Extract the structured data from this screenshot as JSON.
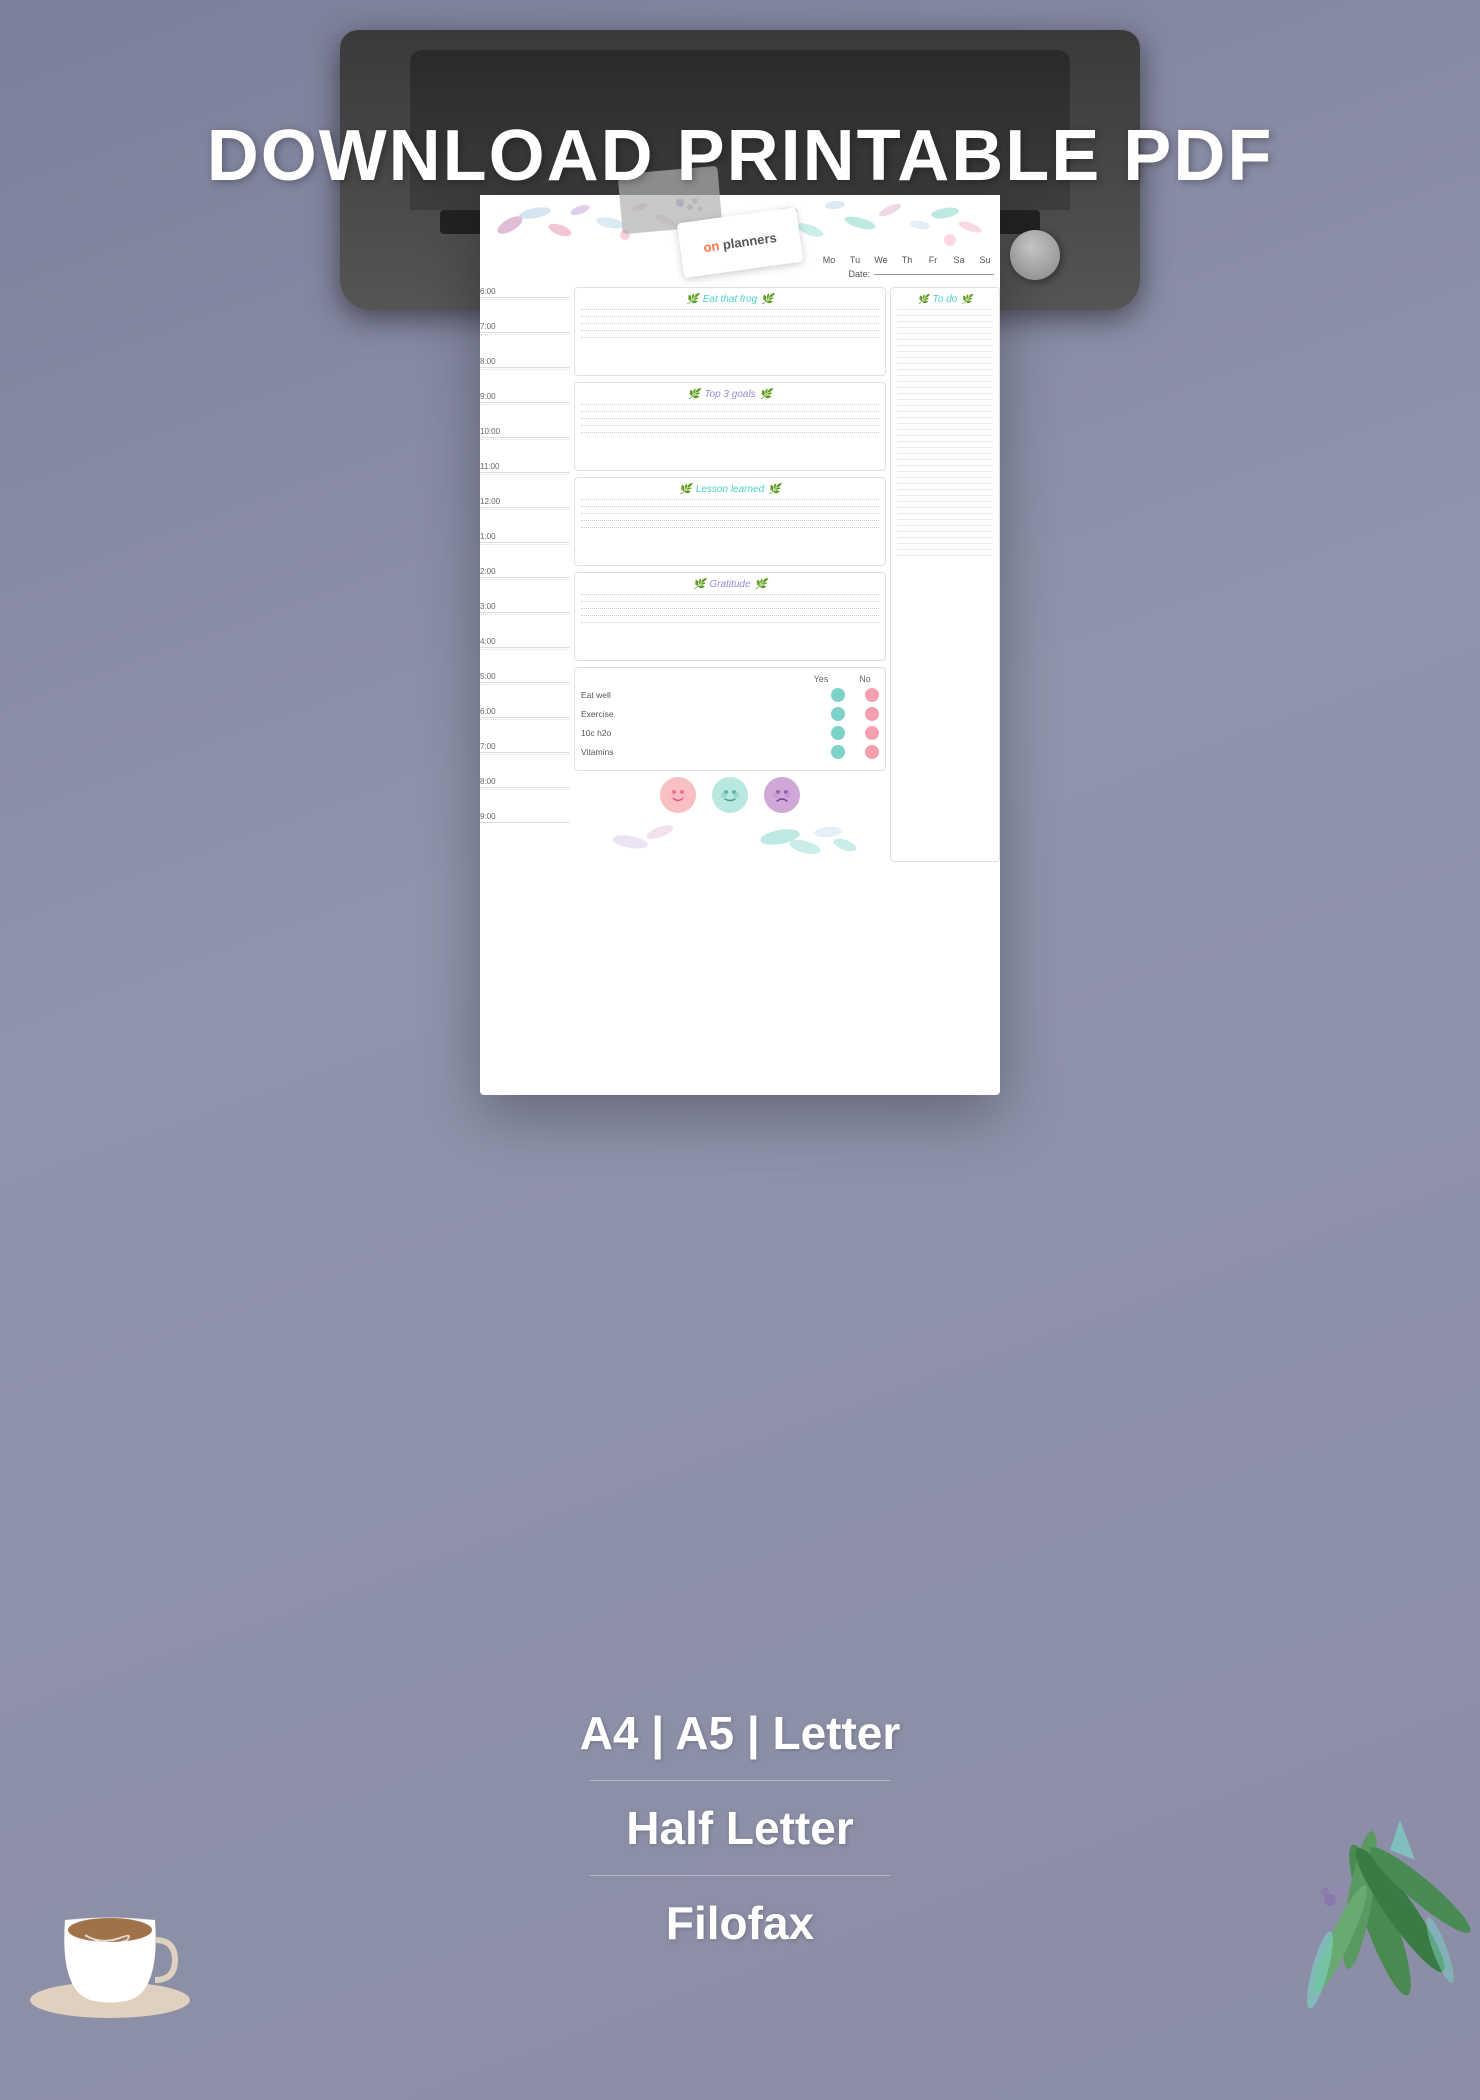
{
  "page": {
    "background_color": "#8b8fa8",
    "header": {
      "title": "DOWNLOAD PRINTABLE PDF"
    },
    "logo": {
      "brand": "on",
      "name": "planners"
    },
    "planner": {
      "days": [
        "Mo",
        "Tu",
        "We",
        "Th",
        "Fr",
        "Sa",
        "Su"
      ],
      "date_label": "Date:",
      "schedule_times": [
        "6:00",
        "7:00",
        "8:00",
        "9:00",
        "10:00",
        "11:00",
        "12:00",
        "1:00",
        "2:00",
        "3:00",
        "4:00",
        "5:00",
        "6:00",
        "7:00",
        "8:00",
        "9:00"
      ],
      "sections": {
        "eat_frog": {
          "title": "Eat that frog",
          "leaf_left": "🌿",
          "leaf_right": "🌿"
        },
        "top3": {
          "title": "Top 3 goals",
          "leaf_left": "🌿",
          "leaf_right": "🌿"
        },
        "lesson": {
          "title": "Lesson learned",
          "leaf_left": "🌿",
          "leaf_right": "🌿"
        },
        "gratitude": {
          "title": "Gratitude",
          "leaf_left": "🌿",
          "leaf_right": "🌿"
        },
        "todo": {
          "title": "To do"
        }
      },
      "habits": {
        "yes_label": "Yes",
        "no_label": "No",
        "items": [
          "Eat well",
          "Exercise",
          "10c h2o",
          "Vitamins"
        ]
      },
      "moods": [
        "😊",
        "😊",
        "😢"
      ]
    },
    "formats": [
      "A4 | A5 | Letter",
      "Half Letter",
      "Filofax"
    ]
  }
}
